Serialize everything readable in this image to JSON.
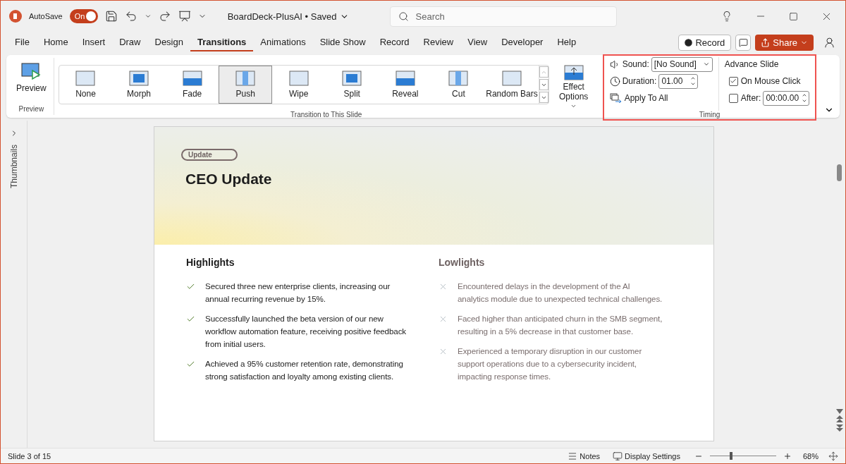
{
  "title_bar": {
    "autosave_label": "AutoSave",
    "autosave_toggle": {
      "label": "On",
      "on": true
    },
    "file_name": "BoardDeck-PlusAI",
    "saved_status": "• Saved",
    "search": {
      "placeholder": "Search"
    }
  },
  "menu_tabs": [
    {
      "label": "File",
      "selected": false
    },
    {
      "label": "Home",
      "selected": false
    },
    {
      "label": "Insert",
      "selected": false
    },
    {
      "label": "Draw",
      "selected": false
    },
    {
      "label": "Design",
      "selected": false
    },
    {
      "label": "Transitions",
      "selected": true
    },
    {
      "label": "Animations",
      "selected": false
    },
    {
      "label": "Slide Show",
      "selected": false
    },
    {
      "label": "Record",
      "selected": false
    },
    {
      "label": "Review",
      "selected": false
    },
    {
      "label": "View",
      "selected": false
    },
    {
      "label": "Developer",
      "selected": false
    },
    {
      "label": "Help",
      "selected": false
    }
  ],
  "record_button": "Record",
  "share_button": "Share",
  "ribbon": {
    "preview": {
      "label": "Preview",
      "group": "Preview"
    },
    "transitions": [
      {
        "label": "None",
        "selected": false
      },
      {
        "label": "Morph",
        "selected": false
      },
      {
        "label": "Fade",
        "selected": false
      },
      {
        "label": "Push",
        "selected": true
      },
      {
        "label": "Wipe",
        "selected": false
      },
      {
        "label": "Split",
        "selected": false
      },
      {
        "label": "Reveal",
        "selected": false
      },
      {
        "label": "Cut",
        "selected": false
      },
      {
        "label": "Random Bars",
        "selected": false
      }
    ],
    "transitions_group": "Transition to This Slide",
    "effect_options": "Effect Options",
    "timing": {
      "sound_label": "Sound:",
      "sound_value": "[No Sound]",
      "duration_label": "Duration:",
      "duration_value": "01.00",
      "apply_all": "Apply To All",
      "advance_title": "Advance Slide",
      "on_mouse_click": {
        "label": "On Mouse Click",
        "checked": true
      },
      "after": {
        "label": "After:",
        "checked": false,
        "value": "00:00.00"
      },
      "group": "Timing"
    }
  },
  "thumbnails_label": "Thumbnails",
  "slide": {
    "tag": "Update",
    "title": "CEO Update",
    "columns": [
      {
        "heading": "Highlights",
        "kind": "positive",
        "items": [
          "Secured three new enterprise clients, increasing our annual recurring revenue by 15%.",
          "Successfully launched the beta version of our new workflow automation feature, receiving positive feedback from initial users.",
          "Achieved a 95% customer retention rate, demonstrating strong satisfaction and loyalty among existing clients."
        ]
      },
      {
        "heading": "Lowlights",
        "kind": "negative",
        "items": [
          "Encountered delays in the development of the AI analytics module due to unexpected technical challenges.",
          "Faced higher than anticipated churn in the SMB segment, resulting in a 5% decrease in that customer base.",
          "Experienced a temporary disruption in our customer support operations due to a cybersecurity incident, impacting response times."
        ]
      }
    ]
  },
  "status_bar": {
    "slide_count": "Slide 3 of 15",
    "notes": "Notes",
    "display_settings": "Display Settings",
    "zoom": {
      "level": 0.32
    },
    "zoom_percent": "68%"
  }
}
